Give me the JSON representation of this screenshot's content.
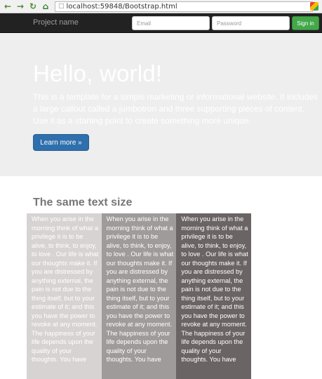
{
  "browser": {
    "url": "localhost:59848/Bootstrap.html",
    "back_icon": "back-arrow",
    "forward_icon": "forward-arrow",
    "reload_icon": "reload",
    "home_icon": "home"
  },
  "navbar": {
    "brand": "Project name",
    "email_placeholder": "Email",
    "password_placeholder": "Password",
    "signin_label": "Sign in",
    "signin_color": "#43a84a"
  },
  "jumbotron": {
    "title": "Hello, world!",
    "text": "This is a template for a simple marketing or informational website. It includes a large callout called a jumbotron and three supporting pieces of content. Use it as a starting point to create something more unique.",
    "button_label": "Learn more »",
    "button_color": "#2f6fad"
  },
  "content": {
    "section_title": "The same text size",
    "columns": [
      {
        "text": "When you arise in the morning think of what a privilege it is to be alive, to think, to enjoy, to love . Our life is what our thoughts make it. If you are distressed by anything external, the pain is not due to the thing itself, but to your estimate of it; and this you have the power to revoke at any moment. The happiness of your life depends upon the quality of your thoughts. You have",
        "color": "#d8d3d3"
      },
      {
        "text": "When you arise in the morning think of what a privilege it is to be alive, to think, to enjoy, to love . Our life is what our thoughts make it. If you are distressed by anything external, the pain is not due to the thing itself, but to your estimate of it; and this you have the power to revoke at any moment. The happiness of your life depends upon the quality of your thoughts. You have",
        "color": "#a09b9b"
      },
      {
        "text": "When you arise in the morning think of what a privilege it is to be alive, to think, to enjoy, to love . Our life is what our thoughts make it. If you are distressed by anything external, the pain is not due to the thing itself, but to your estimate of it; and this you have the power to revoke at any moment. The happiness of your life depends upon the quality of your thoughts. You have",
        "color": "#6b6464"
      }
    ]
  }
}
